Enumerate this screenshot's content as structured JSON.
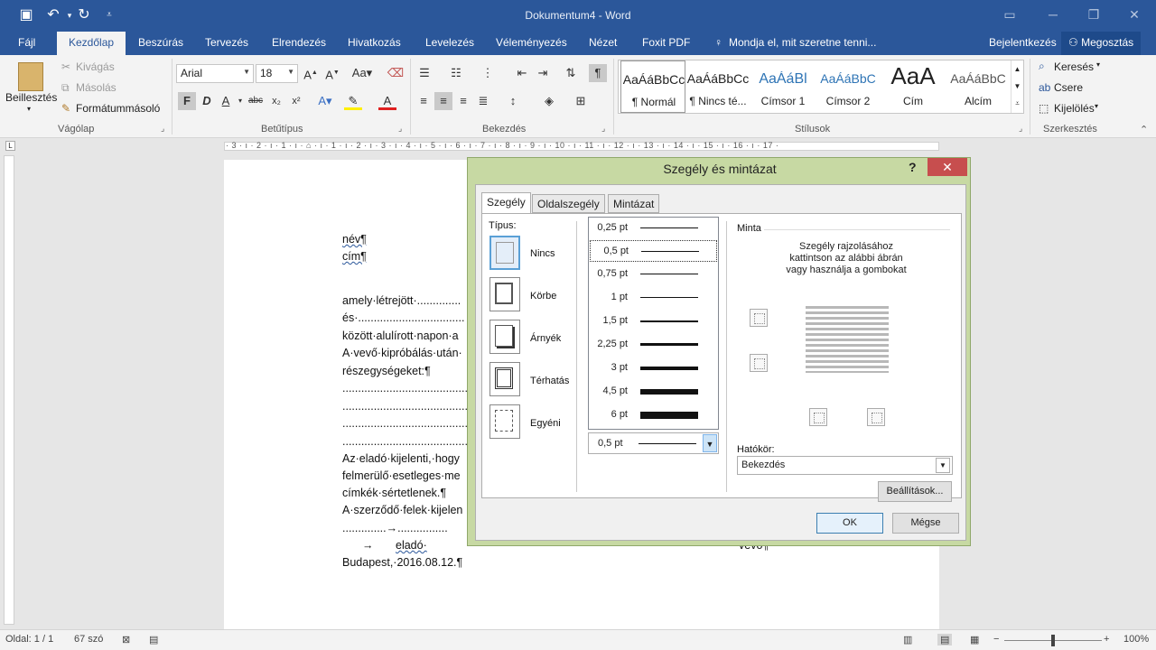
{
  "titlebar": {
    "doc_title": "Dokumentum4 - Word"
  },
  "tabs": [
    {
      "label": "Fájl"
    },
    {
      "label": "Kezdőlap"
    },
    {
      "label": "Beszúrás"
    },
    {
      "label": "Tervezés"
    },
    {
      "label": "Elrendezés"
    },
    {
      "label": "Hivatkozás"
    },
    {
      "label": "Levelezés"
    },
    {
      "label": "Véleményezés"
    },
    {
      "label": "Nézet"
    },
    {
      "label": "Foxit PDF"
    },
    {
      "label": "Mondja el, mit szeretne tenni..."
    }
  ],
  "account": {
    "signin": "Bejelentkezés",
    "share": "Megosztás"
  },
  "clipboard": {
    "paste": "Beillesztés",
    "cut": "Kivágás",
    "copy": "Másolás",
    "format_painter": "Formátummásoló",
    "group": "Vágólap"
  },
  "font": {
    "name": "Arial",
    "size": "18",
    "group": "Betűtípus",
    "bold": "F",
    "italic": "D",
    "underline": "A"
  },
  "paragraph": {
    "group": "Bekezdés"
  },
  "styles": {
    "group": "Stílusok",
    "items": [
      {
        "preview": "AaÁáBbCc",
        "name": "¶ Normál"
      },
      {
        "preview": "AaÁáBbCc",
        "name": "¶ Nincs té..."
      },
      {
        "preview": "AaÁáBl",
        "name": "Címsor 1"
      },
      {
        "preview": "AaÁáBbC",
        "name": "Címsor 2"
      },
      {
        "preview": "AaA",
        "name": "Cím"
      },
      {
        "preview": "AaÁáBbC",
        "name": "Alcím"
      }
    ]
  },
  "editing": {
    "group": "Szerkesztés",
    "find": "Keresés",
    "replace": "Csere",
    "select": "Kijelölés"
  },
  "ruler": {
    "numbers": "· 3 · ı · 2 · ı · 1 · ı · ⌂ · ı · 1 · ı · 2 · ı · 3 · ı · 4 · ı · 5 · ı · 6 · ı · 7 · ı · 8 · ı · 9 · ı · 10 · ı · 11 · ı · 12 · ı · 13 · ı · 14 · ı · 15 · ı · 16 · ı · 17 ·"
  },
  "document": {
    "lines": [
      "név¶",
      "cím¶",
      "amely·létrejött·..............",
      "és·..................................",
      "között·alulírott·napon·a",
      "A·vevő·kipróbálás·után·",
      "részegységeket:¶",
      "........................................",
      "........................................",
      "........................................",
      "........................................",
      "Az·eladó·kijelenti,·hogy",
      "felmerülő·esetleges·me",
      "címkék·sértetlenek.¶",
      "A·szerződő·felek·kijelen",
      "..............→................",
      "eladó·",
      "Budapest,·2016.08.12.¶"
    ],
    "arrow": "→",
    "vevo": "vevő¶"
  },
  "dialog": {
    "title": "Szegély és mintázat",
    "help": "?",
    "tabs": [
      "Szegély",
      "Oldalszegély",
      "Mintázat"
    ],
    "type_label": "Típus:",
    "types": [
      "Nincs",
      "Körbe",
      "Árnyék",
      "Térhatás",
      "Egyéni"
    ],
    "widths": [
      "0,25 pt",
      "0,5 pt",
      "0,75 pt",
      "1 pt",
      "1,5 pt",
      "2,25 pt",
      "3 pt",
      "4,5 pt",
      "6 pt"
    ],
    "selected_width": "0,5 pt",
    "preview_label": "Minta",
    "preview_hint": [
      "Szegély rajzolásához",
      "kattintson az alábbi ábrán",
      "vagy használja a gombokat"
    ],
    "scope_label": "Hatókör:",
    "scope_value": "Bekezdés",
    "options_button": "Beállítások...",
    "ok": "OK",
    "cancel": "Mégse"
  },
  "status": {
    "page": "Oldal: 1 / 1",
    "words": "67 szó",
    "zoom": "100%"
  }
}
